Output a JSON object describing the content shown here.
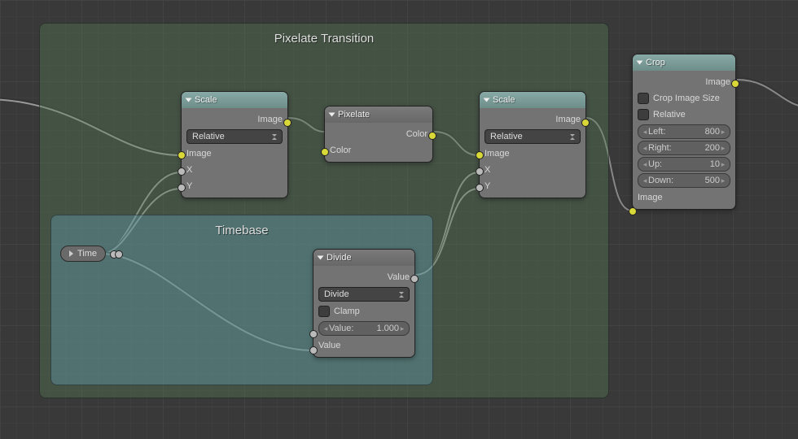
{
  "frames": {
    "outer": {
      "title": "Pixelate Transition"
    },
    "inner": {
      "title": "Timebase"
    }
  },
  "nodes": {
    "scale1": {
      "title": "Scale",
      "out_image": "Image",
      "mode": "Relative",
      "in_image": "Image",
      "in_x": "X",
      "in_y": "Y"
    },
    "pixelate": {
      "title": "Pixelate",
      "out_color": "Color",
      "in_color": "Color"
    },
    "scale2": {
      "title": "Scale",
      "out_image": "Image",
      "mode": "Relative",
      "in_image": "Image",
      "in_x": "X",
      "in_y": "Y"
    },
    "crop": {
      "title": "Crop",
      "out_image": "Image",
      "chk_crop": "Crop Image Size",
      "chk_rel": "Relative",
      "left_label": "Left:",
      "left_val": "800",
      "right_label": "Right:",
      "right_val": "200",
      "up_label": "Up:",
      "up_val": "10",
      "down_label": "Down:",
      "down_val": "500",
      "in_image": "Image"
    },
    "time": {
      "title": "Time"
    },
    "divide": {
      "title": "Divide",
      "out_value": "Value",
      "op": "Divide",
      "clamp": "Clamp",
      "value_label": "Value:",
      "value_val": "1.000",
      "in_value": "Value"
    }
  }
}
